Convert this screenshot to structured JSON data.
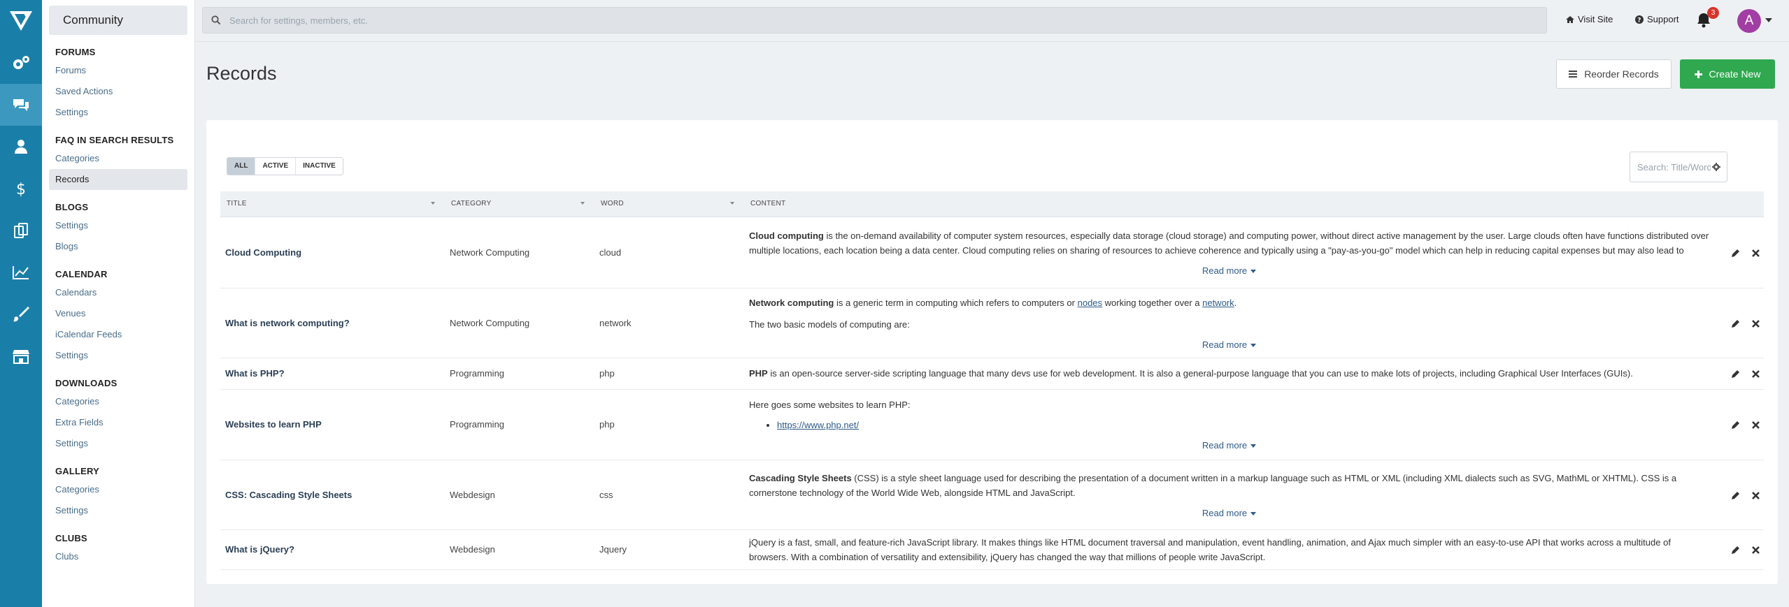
{
  "app": {
    "title": "Community"
  },
  "rail": {
    "items": [
      {
        "icon": "logo-icon",
        "active": false
      },
      {
        "icon": "gears-icon",
        "active": false
      },
      {
        "icon": "comments-icon",
        "active": true
      },
      {
        "icon": "user-icon",
        "active": false
      },
      {
        "icon": "dollar-icon",
        "active": false
      },
      {
        "icon": "copy-icon",
        "active": false
      },
      {
        "icon": "chart-icon",
        "active": false
      },
      {
        "icon": "brush-icon",
        "active": false
      },
      {
        "icon": "shop-icon",
        "active": false
      }
    ]
  },
  "sidebar": {
    "sections": [
      {
        "heading": "FORUMS",
        "items": [
          "Forums",
          "Saved Actions",
          "Settings"
        ]
      },
      {
        "heading": "FAQ IN SEARCH RESULTS",
        "items": [
          "Categories",
          "Records"
        ],
        "active_item": "Records"
      },
      {
        "heading": "BLOGS",
        "items": [
          "Settings",
          "Blogs"
        ]
      },
      {
        "heading": "CALENDAR",
        "items": [
          "Calendars",
          "Venues",
          "iCalendar Feeds",
          "Settings"
        ]
      },
      {
        "heading": "DOWNLOADS",
        "items": [
          "Categories",
          "Extra Fields",
          "Settings"
        ]
      },
      {
        "heading": "GALLERY",
        "items": [
          "Categories",
          "Settings"
        ]
      },
      {
        "heading": "CLUBS",
        "items": [
          "Clubs"
        ]
      }
    ]
  },
  "topbar": {
    "search_placeholder": "Search for settings, members, etc.",
    "visit_site": "Visit Site",
    "support": "Support",
    "notifications_count": "3",
    "avatar_letter": "A"
  },
  "page": {
    "title": "Records",
    "reorder_label": "Reorder Records",
    "create_label": "Create New"
  },
  "table": {
    "filters": [
      "ALL",
      "ACTIVE",
      "INACTIVE"
    ],
    "active_filter": "ALL",
    "search_placeholder": "Search: Title/Word/Description",
    "columns": [
      "TITLE",
      "CATEGORY",
      "WORD",
      "CONTENT"
    ],
    "read_more": "Read more",
    "rows": [
      {
        "title": "Cloud Computing",
        "category": "Network Computing",
        "word": "cloud",
        "content_bold": "Cloud computing",
        "content": " is the on-demand availability of computer system resources, especially data storage (cloud storage) and computing power, without direct active management by the user. Large clouds often have functions distributed over multiple locations, each location being a data center. Cloud computing relies on sharing of resources to achieve coherence and typically using a \"pay-as-you-go\" model which can help in reducing capital expenses but may also lead to unexpected operating expenses for unaware users."
      },
      {
        "title": "What is network computing?",
        "category": "Network Computing",
        "word": "network",
        "content_bold": "Network computing",
        "content_a": " is a generic term in computing which refers to computers or ",
        "link1": "nodes",
        "content_b": " working together over a ",
        "link2": "network",
        "content_c": ".",
        "content2": "The two basic models of computing are:"
      },
      {
        "title": "What is PHP?",
        "category": "Programming",
        "word": "php",
        "content_bold": "PHP",
        "content": " is an open-source server-side scripting language that many devs use for web development. It is also a general-purpose language that you can use to make lots of projects, including Graphical User Interfaces (GUIs)."
      },
      {
        "title": "Websites to learn PHP",
        "category": "Programming",
        "word": "php",
        "content": "Here goes some websites to learn PHP:",
        "link": "https://www.php.net/"
      },
      {
        "title": "CSS: Cascading Style Sheets",
        "category": "Webdesign",
        "word": "css",
        "content_bold": "Cascading Style Sheets",
        "content": " (CSS) is a style sheet language used for describing the presentation of a document written in a markup language such as HTML or XML (including XML dialects such as SVG, MathML or XHTML). CSS is a cornerstone technology of the World Wide Web, alongside HTML and JavaScript."
      },
      {
        "title": "What is jQuery?",
        "category": "Webdesign",
        "word": "Jquery",
        "content": "jQuery is a fast, small, and feature-rich JavaScript library. It makes things like HTML document traversal and manipulation, event handling, animation, and Ajax much simpler with an easy-to-use API that works across a multitude of browsers. With a combination of versatility and extensibility, jQuery has changed the way that millions of people write JavaScript."
      }
    ]
  },
  "colors": {
    "rail": "#1a7fa8",
    "rail_active": "#3c98be",
    "create_button": "#2fa84f",
    "badge": "#d9342b",
    "avatar": "#a23ea3"
  }
}
